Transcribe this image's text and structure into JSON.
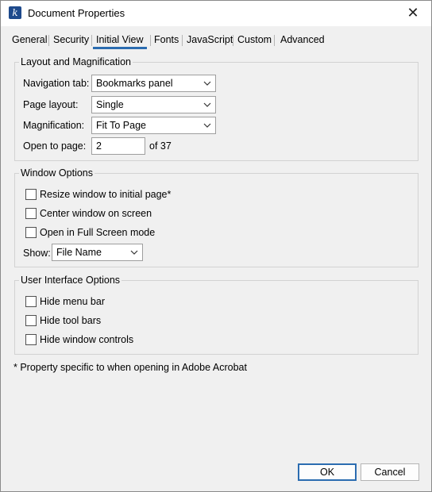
{
  "window": {
    "title": "Document Properties",
    "app_icon_glyph": "k",
    "close_glyph": "✕"
  },
  "tabs": [
    {
      "label": "General",
      "active": false
    },
    {
      "label": "Security",
      "active": false
    },
    {
      "label": "Initial View",
      "active": true
    },
    {
      "label": "Fonts",
      "active": false
    },
    {
      "label": "JavaScript",
      "active": false
    },
    {
      "label": "Custom",
      "active": false
    },
    {
      "label": "Advanced",
      "active": false
    }
  ],
  "layout_group": {
    "legend": "Layout and Magnification",
    "navigation_tab": {
      "label": "Navigation tab:",
      "value": "Bookmarks panel"
    },
    "page_layout": {
      "label": "Page layout:",
      "value": "Single"
    },
    "magnification": {
      "label": "Magnification:",
      "value": "Fit To Page"
    },
    "open_to_page": {
      "label": "Open to page:",
      "value": "2",
      "suffix": "of 37"
    }
  },
  "window_group": {
    "legend": "Window Options",
    "resize": {
      "label": "Resize window to initial page*",
      "checked": false
    },
    "center": {
      "label": "Center window on screen",
      "checked": false
    },
    "fullscreen": {
      "label": "Open in Full Screen mode",
      "checked": false
    },
    "show": {
      "label": "Show:",
      "value": "File Name"
    }
  },
  "ui_group": {
    "legend": "User Interface Options",
    "hide_menu": {
      "label": "Hide menu bar",
      "checked": false
    },
    "hide_toolbars": {
      "label": "Hide tool bars",
      "checked": false
    },
    "hide_controls": {
      "label": "Hide window controls",
      "checked": false
    }
  },
  "footnote": "* Property specific to when opening in Adobe Acrobat",
  "buttons": {
    "ok": "OK",
    "cancel": "Cancel"
  },
  "colors": {
    "accent": "#2b6cb0",
    "app_icon": "#1e4a8c"
  }
}
